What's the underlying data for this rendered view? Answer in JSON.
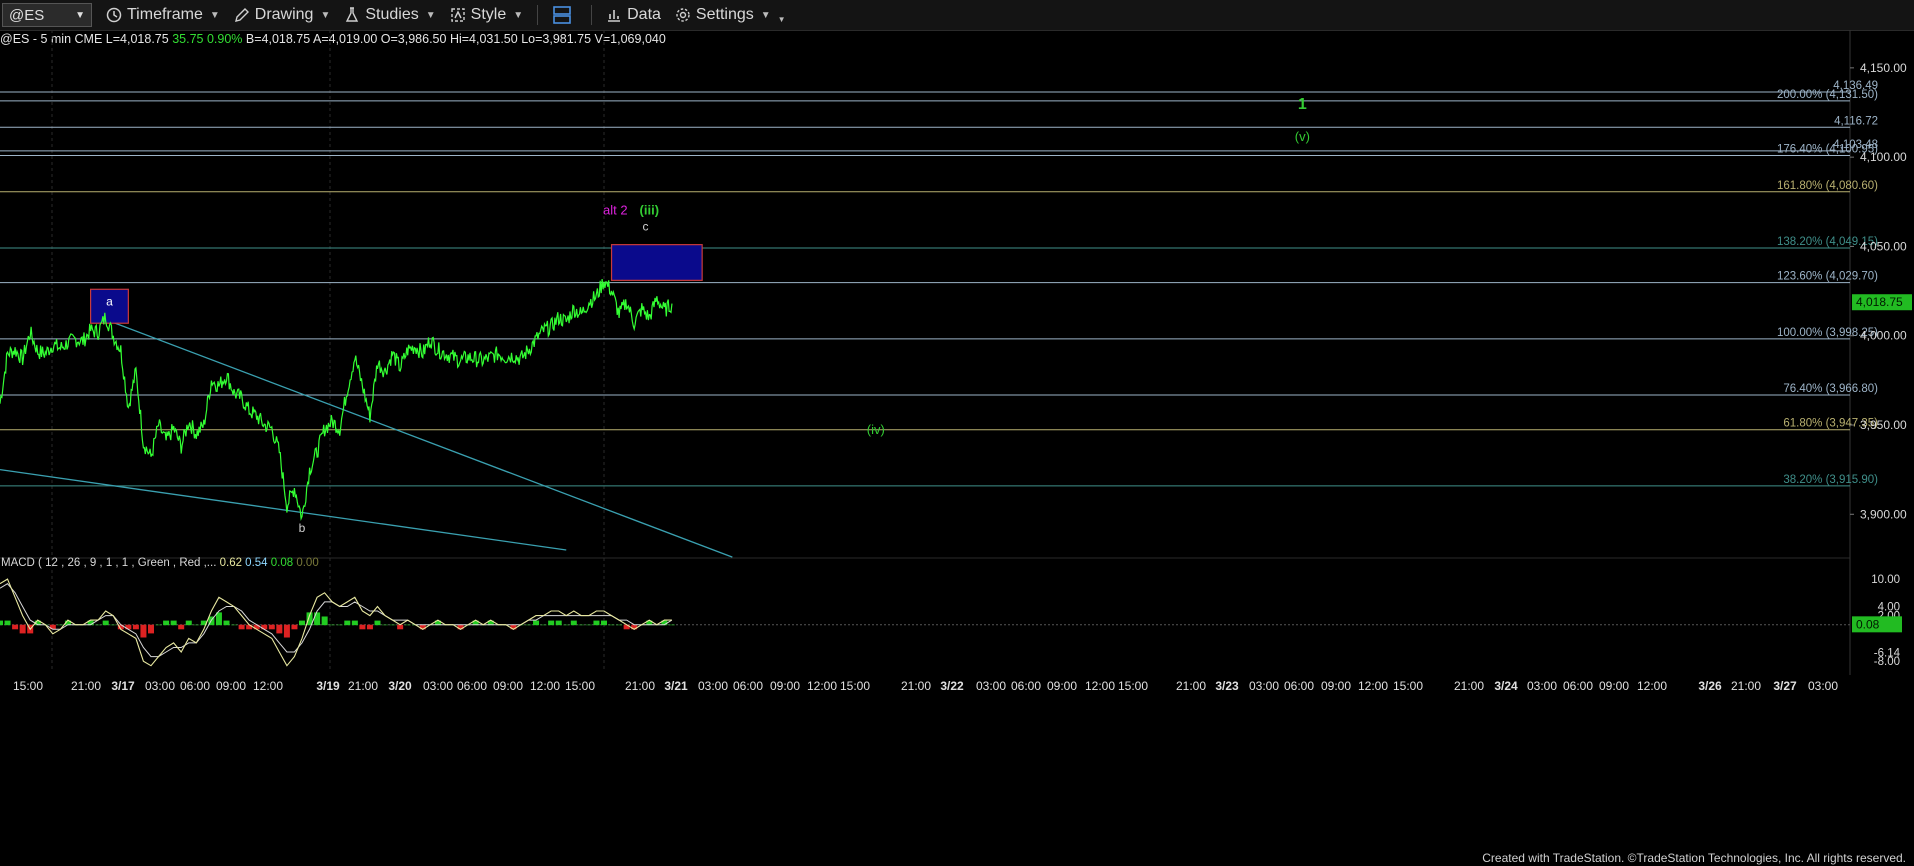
{
  "toolbar": {
    "symbol": "@ES",
    "timeframe": "Timeframe",
    "drawing": "Drawing",
    "studies": "Studies",
    "style": "Style",
    "data": "Data",
    "settings": "Settings"
  },
  "infobar": {
    "symbol_desc": "@ES - 5 min  CME",
    "last": "L=4,018.75",
    "change": "35.75",
    "change_pct": "0.90%",
    "bid": "B=4,018.75",
    "ask": "A=4,019.00",
    "open": "O=3,986.50",
    "high": "Hi=4,031.50",
    "low": "Lo=3,981.75",
    "volume": "V=1,069,040"
  },
  "footer": "Created with TradeStation. ©TradeStation Technologies, Inc. All rights reserved.",
  "colors": {
    "price": "#33ff33",
    "fib_line": "#9db4c8",
    "fib_gold": "#b8b070",
    "trendline": "#3aa0b0",
    "box_fill": "#0a0a8c",
    "box_border": "#c83a3a",
    "macd_line": "#e8e8a0",
    "signal_line": "#d8d8d8",
    "hist_pos": "#22cc22",
    "hist_neg": "#dd2222",
    "wave_green": "#33cc33",
    "wave_magenta": "#dd22dd"
  },
  "chart_data": {
    "type": "line",
    "title": "@ES - 5 min  CME",
    "y_axis": {
      "ticks": [
        3900,
        3950,
        4000,
        4050,
        4100,
        4150
      ],
      "tick_labels": [
        "3,900.00",
        "3,950.00",
        "4,000.00",
        "4,050.00",
        "4,100.00",
        "4,150.00"
      ],
      "ylim": [
        3880,
        4160
      ]
    },
    "current_price": {
      "value": 4018.75,
      "label": "4,018.75"
    },
    "x_axis": {
      "labels": [
        "15:00",
        "21:00",
        "3/17",
        "03:00",
        "06:00",
        "09:00",
        "12:00",
        "3/19",
        "21:00",
        "3/20",
        "03:00",
        "06:00",
        "09:00",
        "12:00",
        "15:00",
        "21:00",
        "3/21",
        "03:00",
        "06:00",
        "09:00",
        "12:00",
        "15:00",
        "21:00",
        "3/22",
        "03:00",
        "06:00",
        "09:00",
        "12:00",
        "15:00",
        "21:00",
        "3/23",
        "03:00",
        "06:00",
        "09:00",
        "12:00",
        "15:00",
        "21:00",
        "3/24",
        "03:00",
        "06:00",
        "09:00",
        "12:00",
        "3/26",
        "21:00",
        "3/27",
        "03:00"
      ],
      "bold_labels": [
        "3/17",
        "3/19",
        "3/20",
        "3/21",
        "3/22",
        "3/23",
        "3/24",
        "3/26",
        "3/27"
      ]
    },
    "price_series": {
      "name": "@ES",
      "points": [
        {
          "t": 0,
          "v": 3962
        },
        {
          "t": 1,
          "v": 3990
        },
        {
          "t": 2,
          "v": 3992
        },
        {
          "t": 3,
          "v": 3987
        },
        {
          "t": 4,
          "v": 4002
        },
        {
          "t": 5,
          "v": 3991
        },
        {
          "t": 6,
          "v": 3990
        },
        {
          "t": 7,
          "v": 3995
        },
        {
          "t": 8,
          "v": 3993
        },
        {
          "t": 9,
          "v": 3996
        },
        {
          "t": 10,
          "v": 3998
        },
        {
          "t": 11,
          "v": 3997
        },
        {
          "t": 12,
          "v": 4003
        },
        {
          "t": 13,
          "v": 4002
        },
        {
          "t": 14,
          "v": 4011
        },
        {
          "t": 15,
          "v": 4000
        },
        {
          "t": 16,
          "v": 3992
        },
        {
          "t": 17,
          "v": 3960
        },
        {
          "t": 18,
          "v": 3980
        },
        {
          "t": 19,
          "v": 3940
        },
        {
          "t": 20,
          "v": 3932
        },
        {
          "t": 21,
          "v": 3950
        },
        {
          "t": 22,
          "v": 3941
        },
        {
          "t": 23,
          "v": 3948
        },
        {
          "t": 24,
          "v": 3938
        },
        {
          "t": 25,
          "v": 3952
        },
        {
          "t": 26,
          "v": 3945
        },
        {
          "t": 27,
          "v": 3950
        },
        {
          "t": 28,
          "v": 3975
        },
        {
          "t": 29,
          "v": 3972
        },
        {
          "t": 30,
          "v": 3978
        },
        {
          "t": 31,
          "v": 3968
        },
        {
          "t": 32,
          "v": 3965
        },
        {
          "t": 33,
          "v": 3958
        },
        {
          "t": 34,
          "v": 3955
        },
        {
          "t": 35,
          "v": 3950
        },
        {
          "t": 36,
          "v": 3948
        },
        {
          "t": 37,
          "v": 3935
        },
        {
          "t": 38,
          "v": 3905
        },
        {
          "t": 39,
          "v": 3915
        },
        {
          "t": 40,
          "v": 3898
        },
        {
          "t": 41,
          "v": 3925
        },
        {
          "t": 42,
          "v": 3935
        },
        {
          "t": 43,
          "v": 3948
        },
        {
          "t": 44,
          "v": 3952
        },
        {
          "t": 45,
          "v": 3948
        },
        {
          "t": 46,
          "v": 3970
        },
        {
          "t": 47,
          "v": 3988
        },
        {
          "t": 48,
          "v": 3972
        },
        {
          "t": 49,
          "v": 3955
        },
        {
          "t": 50,
          "v": 3985
        },
        {
          "t": 51,
          "v": 3980
        },
        {
          "t": 52,
          "v": 3990
        },
        {
          "t": 53,
          "v": 3982
        },
        {
          "t": 54,
          "v": 3992
        },
        {
          "t": 55,
          "v": 3994
        },
        {
          "t": 56,
          "v": 3990
        },
        {
          "t": 57,
          "v": 3998
        },
        {
          "t": 58,
          "v": 3992
        },
        {
          "t": 59,
          "v": 3990
        },
        {
          "t": 60,
          "v": 3988
        },
        {
          "t": 61,
          "v": 3986
        },
        {
          "t": 62,
          "v": 3988
        },
        {
          "t": 63,
          "v": 3987
        },
        {
          "t": 64,
          "v": 3986
        },
        {
          "t": 65,
          "v": 3988
        },
        {
          "t": 66,
          "v": 3990
        },
        {
          "t": 67,
          "v": 3988
        },
        {
          "t": 68,
          "v": 3989
        },
        {
          "t": 69,
          "v": 3987
        },
        {
          "t": 70,
          "v": 3992
        },
        {
          "t": 71,
          "v": 3998
        },
        {
          "t": 72,
          "v": 4003
        },
        {
          "t": 73,
          "v": 4005
        },
        {
          "t": 74,
          "v": 4010
        },
        {
          "t": 75,
          "v": 4008
        },
        {
          "t": 76,
          "v": 4015
        },
        {
          "t": 77,
          "v": 4012
        },
        {
          "t": 78,
          "v": 4019
        },
        {
          "t": 79,
          "v": 4022
        },
        {
          "t": 80,
          "v": 4031
        },
        {
          "t": 81,
          "v": 4025
        },
        {
          "t": 82,
          "v": 4012
        },
        {
          "t": 83,
          "v": 4019
        },
        {
          "t": 84,
          "v": 4007
        },
        {
          "t": 85,
          "v": 4015
        },
        {
          "t": 86,
          "v": 4010
        },
        {
          "t": 87,
          "v": 4021
        },
        {
          "t": 88,
          "v": 4014
        },
        {
          "t": 89,
          "v": 4018
        }
      ]
    },
    "fib_levels": [
      {
        "value": 4136.49,
        "label": "4,136.49",
        "style": "grey"
      },
      {
        "value": 4131.5,
        "label": "200.00% (4,131.50)",
        "style": "grey"
      },
      {
        "value": 4116.72,
        "label": "4,116.72",
        "style": "grey"
      },
      {
        "value": 4103.48,
        "label": "4,103.48",
        "style": "grey"
      },
      {
        "value": 4100.95,
        "label": "176.40% (4,100.95)",
        "style": "grey"
      },
      {
        "value": 4080.6,
        "label": "161.80% (4,080.60)",
        "style": "gold"
      },
      {
        "value": 4049.15,
        "label": "138.20% (4,049.15)",
        "style": "teal"
      },
      {
        "value": 4029.7,
        "label": "123.60% (4,029.70)",
        "style": "grey"
      },
      {
        "value": 3998.25,
        "label": "100.00% (3,998.25)",
        "style": "grey"
      },
      {
        "value": 3966.8,
        "label": "76.40% (3,966.80)",
        "style": "grey"
      },
      {
        "value": 3947.35,
        "label": "61.80% (3,947.35)",
        "style": "gold"
      },
      {
        "value": 3915.9,
        "label": "38.20% (3,915.90)",
        "style": "teal"
      }
    ],
    "trendlines": [
      {
        "from": {
          "t": 14,
          "v": 4009
        },
        "to": {
          "t": 97,
          "v": 3876
        }
      },
      {
        "from": {
          "t": 0,
          "v": 3925
        },
        "to": {
          "t": 75,
          "v": 3880
        }
      }
    ],
    "boxes": [
      {
        "name": "a",
        "t1": 12,
        "t2": 17,
        "v1": 4026,
        "v2": 4007
      },
      {
        "name": "target",
        "t1": 81,
        "t2": 93,
        "v1": 4051,
        "v2": 4031
      }
    ],
    "wave_labels": [
      {
        "text": "a",
        "t": 14.5,
        "v": 4017,
        "color": "white"
      },
      {
        "text": "b",
        "t": 40,
        "v": 3890,
        "color": "grey"
      },
      {
        "text": "c",
        "t": 85.5,
        "v": 4059,
        "color": "grey"
      },
      {
        "text": "alt 2",
        "t": 81.5,
        "v": 4068,
        "color": "magenta"
      },
      {
        "text": "(iii)",
        "t": 86,
        "v": 4068,
        "color": "green"
      },
      {
        "text": "(iv)",
        "t": 116,
        "v": 3945,
        "color": "green"
      },
      {
        "text": "(v)",
        "t": 172.5,
        "v": 4109,
        "color": "green"
      },
      {
        "text": "1",
        "t": 172.5,
        "v": 4127,
        "color": "green"
      }
    ],
    "macd": {
      "label": "MACD ( 12 , 26 , 9 , 1 , 1 , Green , Red ,...",
      "macd_value": "0.62",
      "signal_value": "0.54",
      "diff_value": "0.08",
      "zero_value": "0.00",
      "axis_ticks": [
        {
          "value": 10,
          "label": "10.00"
        },
        {
          "value": 4,
          "label": "4.00"
        },
        {
          "value": 2,
          "label": "2.00"
        },
        {
          "value": -6.14,
          "label": "-6.14"
        },
        {
          "value": -8,
          "label": "-8.00"
        }
      ],
      "current_label": "0.08",
      "ylim": [
        -9.5,
        12
      ],
      "macd_line": [
        9,
        10,
        6,
        2,
        -1,
        1,
        0,
        -2,
        -1,
        1,
        0,
        0,
        1,
        1,
        3,
        2,
        -1,
        -2,
        -3,
        -8,
        -9,
        -7,
        -5,
        -4,
        -6,
        -3,
        -4,
        -1,
        3,
        6,
        5,
        4,
        2,
        0,
        -1,
        -2,
        -3,
        -6,
        -9,
        -7,
        -3,
        2,
        6,
        7,
        5,
        4,
        5,
        6,
        3,
        2,
        4,
        2,
        1,
        0,
        1,
        0,
        -1,
        0,
        1,
        0,
        0,
        -1,
        0,
        1,
        0,
        1,
        0,
        0,
        -1,
        0,
        1,
        2,
        2,
        3,
        3,
        2,
        3,
        2,
        2,
        3,
        3,
        2,
        1,
        0,
        -1,
        0,
        1,
        0,
        1,
        1
      ],
      "signal_line": [
        8,
        9,
        7,
        4,
        1,
        0,
        0,
        -1,
        -1,
        0,
        0,
        0,
        0,
        1,
        2,
        2,
        0,
        -1,
        -2,
        -5,
        -7,
        -7,
        -6,
        -5,
        -5,
        -4,
        -4,
        -2,
        1,
        3,
        4,
        4,
        3,
        1,
        0,
        -1,
        -2,
        -4,
        -6,
        -6,
        -4,
        -1,
        3,
        5,
        5,
        4,
        4,
        5,
        4,
        3,
        3,
        2,
        1,
        1,
        1,
        0,
        0,
        0,
        0,
        0,
        0,
        0,
        0,
        0,
        0,
        0,
        0,
        0,
        0,
        0,
        1,
        1,
        2,
        2,
        2,
        2,
        2,
        2,
        2,
        2,
        2,
        2,
        1,
        1,
        0,
        0,
        0,
        0,
        0,
        1
      ],
      "histogram": [
        1,
        1,
        -1,
        -2,
        -2,
        1,
        0,
        -1,
        0,
        1,
        0,
        0,
        1,
        0,
        1,
        0,
        -1,
        -1,
        -1,
        -3,
        -2,
        0,
        1,
        1,
        -1,
        1,
        0,
        1,
        2,
        3,
        1,
        0,
        -1,
        -1,
        -1,
        -1,
        -1,
        -2,
        -3,
        -1,
        1,
        3,
        3,
        2,
        0,
        0,
        1,
        1,
        -1,
        -1,
        1,
        0,
        0,
        -1,
        0,
        0,
        -1,
        0,
        1,
        0,
        0,
        -1,
        0,
        1,
        0,
        1,
        0,
        0,
        -1,
        0,
        0,
        1,
        0,
        1,
        1,
        0,
        1,
        0,
        0,
        1,
        1,
        0,
        0,
        -1,
        -1,
        0,
        1,
        0,
        1,
        0
      ]
    }
  }
}
